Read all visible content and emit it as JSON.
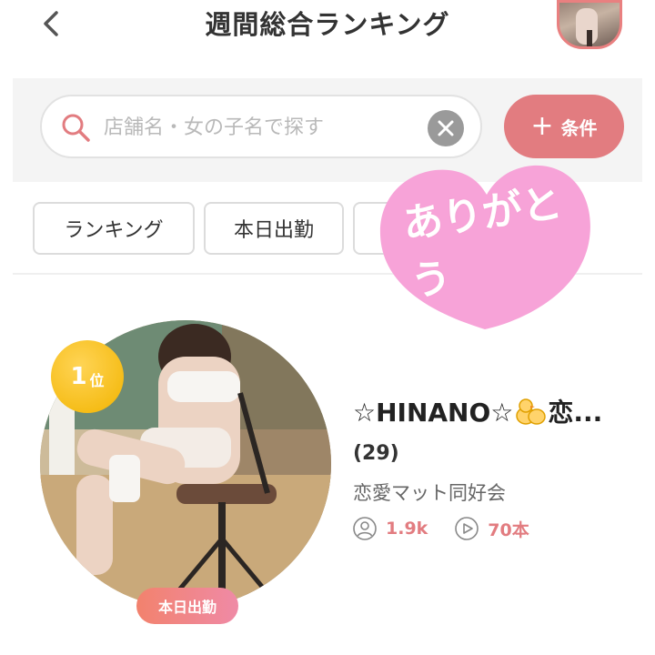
{
  "header": {
    "title": "週間総合ランキング"
  },
  "search": {
    "placeholder": "店舗名・女の子名で探す",
    "condition_label": "条件"
  },
  "tabs": [
    {
      "label": "ランキング"
    },
    {
      "label": "本日出勤"
    }
  ],
  "sticker": {
    "line1": "ありがとう"
  },
  "ranking": {
    "rank_number": "1",
    "rank_unit": "位",
    "badge": "本日出勤",
    "name_prefix": "☆HINANO☆",
    "name_suffix": "恋...",
    "age": "(29)",
    "shop": "恋愛マット同好会",
    "followers": "1.9k",
    "videos": "70本"
  },
  "colors": {
    "accent": "#e27c80",
    "rank_gold": "#f2b400",
    "sticker_pink": "#f7a3d8"
  },
  "icons": [
    "back-chevron-icon",
    "search-icon",
    "clear-icon",
    "plus-icon",
    "user-icon",
    "play-icon",
    "chick-emoji-icon"
  ]
}
